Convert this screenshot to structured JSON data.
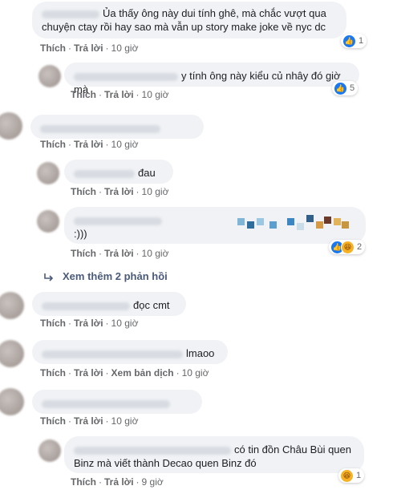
{
  "actions": {
    "like": "Thích",
    "reply": "Trả lời",
    "translate": "Xem bản dịch",
    "sep": "·"
  },
  "comments": [
    {
      "line1": "Ủa thấy ông này dui tính ghê, mà chắc vượt qua",
      "line2": "chuyện ctay rồi hay sao mà vẫn up story make joke về nyc dc",
      "time": "10 giờ",
      "reactions": {
        "type": "like",
        "count": "1"
      }
    },
    {
      "text": "y tính ông này kiểu củ nhây đó giờ mà",
      "time": "10 giờ",
      "reactions": {
        "type": "like",
        "count": "5"
      }
    },
    {
      "text": "",
      "time": "10 giờ"
    },
    {
      "text": "đau",
      "time": "10 giờ"
    },
    {
      "text": ":)))",
      "time": "10 giờ",
      "reactions": {
        "type": "like-haha",
        "count": "2"
      }
    },
    {
      "text": "đọc cmt",
      "time": "10 giờ"
    },
    {
      "text": "lmaoo",
      "time": "10 giờ"
    },
    {
      "text": "",
      "time": "10 giờ"
    },
    {
      "line1": "có tin đồn Châu Bùi quen",
      "line2": "Binz mà viết thành Decao quen Binz đó",
      "time": "9 giờ",
      "reactions": {
        "type": "haha",
        "count": "1"
      }
    }
  ],
  "more_replies": "Xem thêm 2 phản hồi",
  "icons": {
    "like": "like-icon",
    "haha": "haha-icon",
    "reply_arrow": "reply-arrow-icon"
  },
  "colors": {
    "bubble_bg": "#f0f2f5",
    "action_text": "#65676b",
    "like_blue": "#1877f2",
    "haha_yellow": "#f7b125"
  }
}
